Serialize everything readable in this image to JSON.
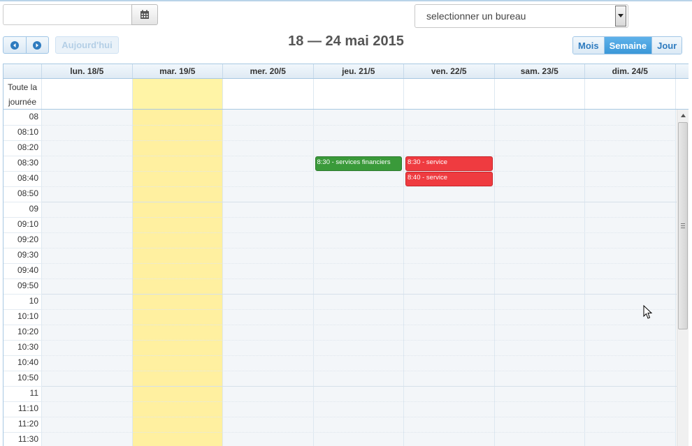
{
  "toolbar": {
    "date_input_value": "",
    "calendar_icon": "calendar-icon",
    "office_select": {
      "selected": "selectionner un bureau"
    },
    "prev_icon": "chevron-left-icon",
    "next_icon": "chevron-right-icon",
    "today_label": "Aujourd'hui",
    "range_title": "18 — 24 mai 2015",
    "views": [
      {
        "label": "Mois",
        "active": false
      },
      {
        "label": "Semaine",
        "active": true
      },
      {
        "label": "Jour",
        "active": false
      }
    ]
  },
  "calendar": {
    "days": [
      "lun. 18/5",
      "mar. 19/5",
      "mer. 20/5",
      "jeu. 21/5",
      "ven. 22/5",
      "sam. 23/5",
      "dim. 24/5"
    ],
    "today": "mar. 19/5",
    "allday_label_line1": "Toute la",
    "allday_label_line2": "journée",
    "time_slots": [
      "08",
      "08:10",
      "08:20",
      "08:30",
      "08:40",
      "08:50",
      "09",
      "09:10",
      "09:20",
      "09:30",
      "09:40",
      "09:50",
      "10",
      "10:10",
      "10:20",
      "10:30",
      "10:40",
      "10:50",
      "11",
      "11:10",
      "11:20",
      "11:30"
    ],
    "events": [
      {
        "day": "jeu. 21/5",
        "start": "08:30",
        "text": "8:30 - services financiers",
        "color": "#3a9a3a"
      },
      {
        "day": "ven. 22/5",
        "start": "08:30",
        "text": "8:30 - service",
        "color": "#ef3b40"
      },
      {
        "day": "ven. 22/5",
        "start": "08:40",
        "text": "8:40 - service",
        "color": "#ef3b40"
      }
    ],
    "today_color": "#fff0a0",
    "accent_color": "#3a97d8"
  }
}
